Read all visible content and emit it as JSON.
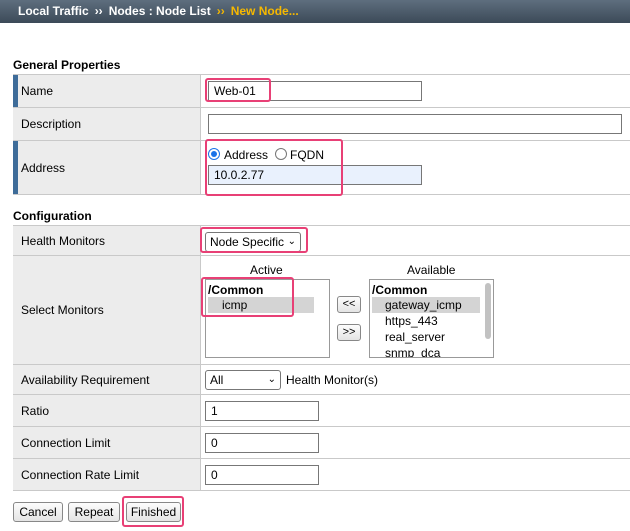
{
  "breadcrumb": {
    "part1": "Local Traffic",
    "sep1": "››",
    "part2": "Nodes : Node List",
    "sep2": "››",
    "part3": "New Node..."
  },
  "general": {
    "title": "General Properties",
    "name_label": "Name",
    "name_value": "Web-01",
    "description_label": "Description",
    "description_value": "",
    "address_label": "Address",
    "address_option": "Address",
    "fqdn_option": "FQDN",
    "address_value": "10.0.2.77"
  },
  "configuration": {
    "title": "Configuration",
    "health_monitors_label": "Health Monitors",
    "health_monitors_value": "Node Specific",
    "select_monitors_label": "Select Monitors",
    "active_header": "Active",
    "available_header": "Available",
    "active_items": [
      "/Common",
      "icmp"
    ],
    "available_items": [
      "/Common",
      "gateway_icmp",
      "https_443",
      "real_server",
      "snmp_dca"
    ],
    "move_left_label": "<<",
    "move_right_label": ">>",
    "availability_label": "Availability Requirement",
    "availability_value": "All",
    "availability_suffix": "Health Monitor(s)",
    "ratio_label": "Ratio",
    "ratio_value": "1",
    "conn_limit_label": "Connection Limit",
    "conn_limit_value": "0",
    "conn_rate_label": "Connection Rate Limit",
    "conn_rate_value": "0"
  },
  "buttons": {
    "cancel": "Cancel",
    "repeat": "Repeat",
    "finished": "Finished"
  },
  "colors": {
    "highlight": "#e84076",
    "required_bar": "#3e6c99",
    "breadcrumb_current": "#f6b800"
  }
}
